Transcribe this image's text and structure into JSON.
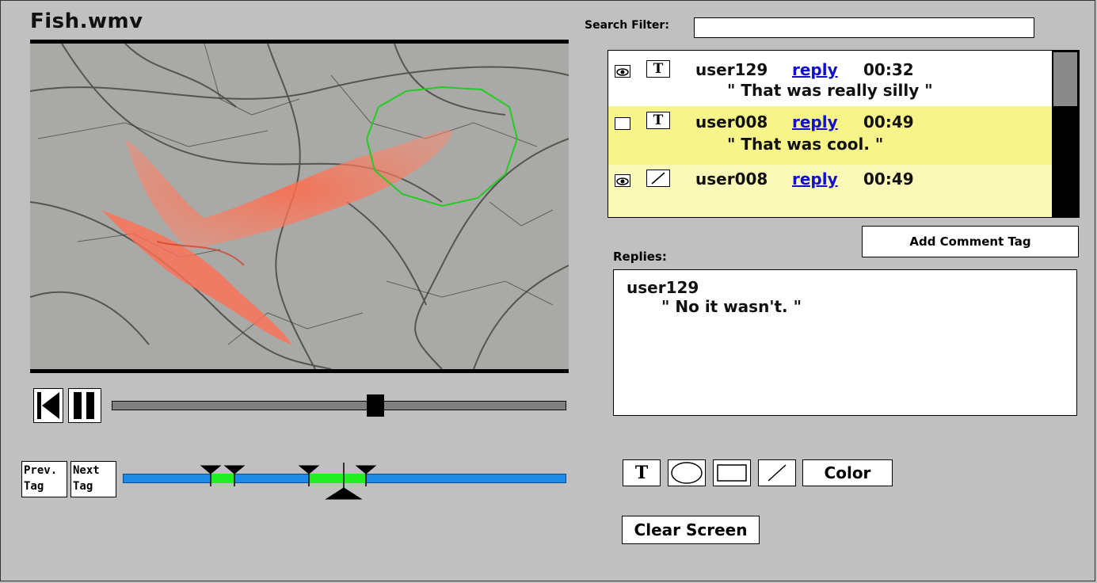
{
  "video": {
    "title": "Fish.wmv",
    "playback_position": 0.58
  },
  "transport": {
    "restart_icon": "skip-to-start-icon",
    "pause_icon": "pause-icon"
  },
  "tags": {
    "prev_label_1": "Prev.",
    "prev_label_2": "Tag",
    "next_label_1": "Next",
    "next_label_2": "Tag"
  },
  "search": {
    "label": "Search Filter:",
    "value": ""
  },
  "comments": [
    {
      "visible": true,
      "type_icon": "text-tool-icon",
      "user": "user129",
      "reply": "reply",
      "time": "00:32",
      "text": "\" That was really silly \"",
      "highlight": "#ffffff"
    },
    {
      "visible": false,
      "type_icon": "text-tool-icon",
      "user": "user008",
      "reply": "reply",
      "time": "00:49",
      "text": "\" That was cool. \"",
      "highlight": "#f7f48a"
    },
    {
      "visible": true,
      "type_icon": "pen-tool-icon",
      "user": "user008",
      "reply": "reply",
      "time": "00:49",
      "text": "",
      "highlight": "#fbf9b8"
    }
  ],
  "add_tag": {
    "label": "Add Comment Tag"
  },
  "replies": {
    "label": "Replies:",
    "user": "user129",
    "text": "\"  No it wasn't.  \""
  },
  "tools": {
    "color_label": "Color",
    "clear_label": "Clear Screen",
    "icons": [
      "text-tool-icon",
      "ellipse-tool-icon",
      "rectangle-tool-icon",
      "pen-tool-icon"
    ]
  },
  "colors": {
    "background": "#c0c0c0",
    "timeline": "#1e8ce6",
    "tag_segment": "#22ee22",
    "link": "#1010cc",
    "highlight_row": "#f7f48a",
    "annotation_circle": "#22cc22"
  }
}
